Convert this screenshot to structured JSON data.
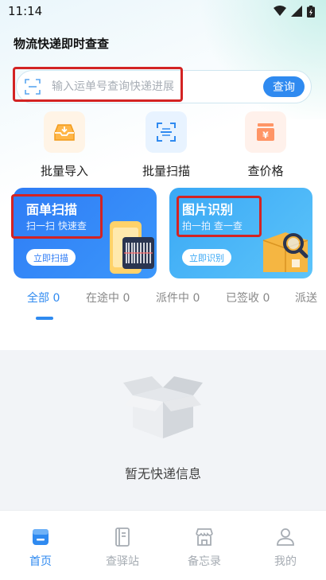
{
  "status_bar": {
    "time": "11:14"
  },
  "header": {
    "title": "物流快递即时查查"
  },
  "search": {
    "placeholder": "输入运单号查询快递进展",
    "button_label": "查询"
  },
  "quick_actions": [
    {
      "label": "批量导入",
      "icon": "inbox-import-icon"
    },
    {
      "label": "批量扫描",
      "icon": "scan-icon"
    },
    {
      "label": "查价格",
      "icon": "price-icon"
    }
  ],
  "cards": [
    {
      "title": "面单扫描",
      "subtitle": "扫一扫 快速查",
      "button": "立即扫描"
    },
    {
      "title": "图片识别",
      "subtitle": "拍一拍 查一查",
      "button": "立即识别"
    }
  ],
  "tabs": [
    {
      "label": "全部 0"
    },
    {
      "label": "在途中 0"
    },
    {
      "label": "派件中 0"
    },
    {
      "label": "已签收 0"
    },
    {
      "label": "派送"
    }
  ],
  "empty_state": {
    "text": "暂无快递信息"
  },
  "bottom_nav": [
    {
      "label": "首页",
      "icon": "home-icon",
      "active": true
    },
    {
      "label": "查驿站",
      "icon": "book-icon"
    },
    {
      "label": "备忘录",
      "icon": "shop-icon"
    },
    {
      "label": "我的",
      "icon": "user-icon"
    }
  ],
  "colors": {
    "accent": "#2f8af0",
    "highlight": "#d32323"
  }
}
